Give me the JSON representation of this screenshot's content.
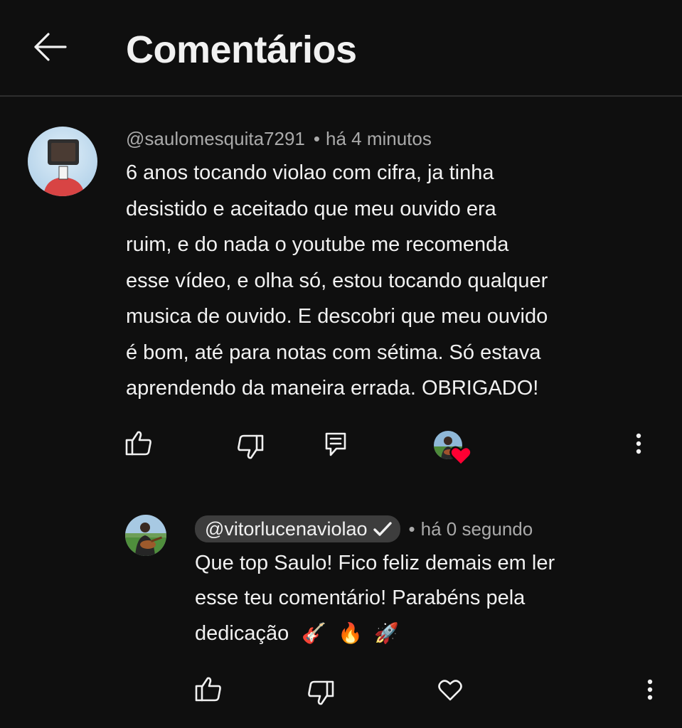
{
  "header": {
    "title": "Comentários",
    "back_icon": "arrow-left-icon"
  },
  "comment": {
    "author": "@saulomesquita7291",
    "separator": "•",
    "time": "há 4 minutos",
    "text_lines": [
      "6 anos tocando violao com cifra, ja tinha",
      "desistido e aceitado que meu ouvido era",
      "ruim, e do nada o youtube me recomenda",
      "esse vídeo, e olha só, estou tocando qualquer",
      "musica de ouvido. E descobri que meu ouvido",
      "é bom, até para notas com sétima. Só estava",
      "aprendendo da maneira errada. OBRIGADO!"
    ],
    "actions": {
      "like_icon": "thumbs-up-icon",
      "dislike_icon": "thumbs-down-icon",
      "reply_icon": "comment-reply-icon",
      "creator_heart": "creator-heart-badge",
      "more_icon": "more-vertical-icon"
    }
  },
  "reply": {
    "author": "@vitorlucenaviolao",
    "verified": "verified-check-icon",
    "separator": "•",
    "time": "há 0 segundo",
    "text_lines": [
      "Que top Saulo! Fico feliz demais em ler",
      "esse teu comentário! Parabéns pela",
      "dedicação"
    ],
    "emojis": [
      "🎸",
      "🔥",
      "🚀"
    ],
    "actions": {
      "like_icon": "thumbs-up-icon",
      "dislike_icon": "thumbs-down-icon",
      "heart_icon": "heart-outline-icon",
      "more_icon": "more-vertical-icon"
    }
  },
  "colors": {
    "background": "#0f0f0f",
    "text": "#f1f1f1",
    "secondary_text": "#aaaaaa",
    "chip_background": "#3d3d3d",
    "heart_red": "#ff0033",
    "divider": "#2e2e2e"
  }
}
